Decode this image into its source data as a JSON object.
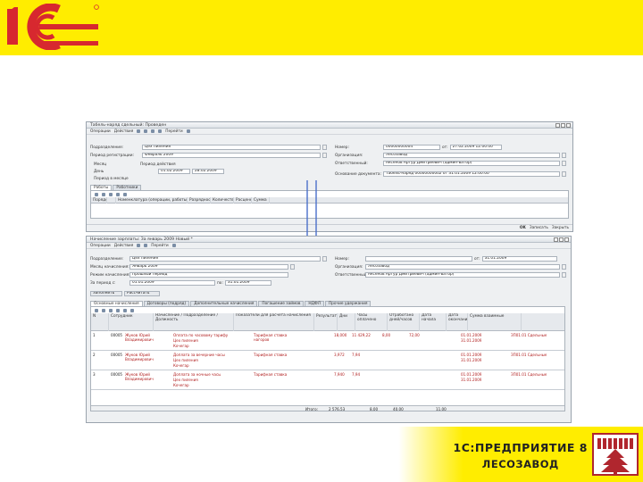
{
  "brand": {
    "logo_text": "1С",
    "accent": "#ffed00",
    "logo_color": "#d7282f"
  },
  "product": {
    "line1": "1С:ПРЕДПРИЯТИЕ 8",
    "line2": "ЛЕСОЗАВОД"
  },
  "win1": {
    "title": "Табель-наряд сдельный: Проведен",
    "toolbar": [
      "Операции",
      "Действия",
      "Перейти"
    ],
    "left_fields": [
      {
        "label": "Подразделение:",
        "value": "Цех пиления"
      },
      {
        "label": "Период регистрации:",
        "value": "Февраль 2009"
      }
    ],
    "period": {
      "label": "Период действия",
      "opt1": "Месяц",
      "opt2": "День",
      "opt3": "Период в месяце",
      "from": "01.02.2009",
      "to": "28.02.2009"
    },
    "right_fields": [
      {
        "label": "Номер:",
        "value": "00000000004",
        "date_label": "от:",
        "date": "27.02.2009 12:00:00"
      },
      {
        "label": "Организация:",
        "value": "Лесозавод"
      },
      {
        "label": "Ответственный:",
        "value": "Аксенов Артур Дмитриевич (админ-ватор)"
      },
      {
        "label": "Основание документа:",
        "value": "Табель-наряд 00000000002 от 31.01.2009 12:00:00"
      }
    ],
    "tabs": [
      "Работы",
      "Работники"
    ],
    "grid_header": [
      "Порядок",
      "",
      "Номенклатура (операции, работы)",
      "Разрядность",
      "Количество",
      "Расценка",
      "Сумма"
    ],
    "bottom": {
      "ok": "OK",
      "write": "Записать",
      "close": "Закрыть"
    }
  },
  "win2": {
    "title": "Начисление зарплаты: За январь 2009 Новый *",
    "toolbar": [
      "Операции",
      "Действия",
      "Перейти"
    ],
    "left_fields": [
      {
        "label": "Подразделение:",
        "value": "Цех пиления"
      },
      {
        "label": "Месяц начисления:",
        "value": "Январь 2009"
      },
      {
        "label": "Режим начисления:",
        "value": "Прошлый период"
      },
      {
        "label": "За период с:",
        "value": "01.01.2009",
        "to_label": "по:",
        "to": "31.01.2009"
      }
    ],
    "right_fields": [
      {
        "label": "Номер:",
        "value": "",
        "date_label": "от:",
        "date": "31.01.2009"
      },
      {
        "label": "Организация:",
        "value": "Лесозавод"
      },
      {
        "label": "Ответственный:",
        "value": "Аксенов Артур Дмитриевич (админ-ватор)"
      }
    ],
    "actions": [
      "Заполнить",
      "Рассчитать"
    ],
    "tabs": [
      "Основные начисления",
      "Договоры (подряд)",
      "Дополнительные начисления",
      "Погашение займов",
      "НДФЛ",
      "Прочие удержания"
    ],
    "columns": [
      "N",
      "Сотрудник",
      "Начисление / Подразделение / Должность",
      "Показатели для расчета начисления",
      "Результат",
      "Дни",
      "Часы оплачено",
      "Отработано дней/часов",
      "Дата начала",
      "Дата окончания",
      "Сумма взаимные"
    ],
    "rows": [
      {
        "n": "1",
        "code": "00005",
        "emp": "Жуков Юрий",
        "emp2": "Владимирович",
        "acc": "Оплата по часовому тарифу",
        "dept": "Цех пиления",
        "pos": "Кочегар",
        "basis": "Тарифная ставка",
        "basis2": "нагоров",
        "res": "18,000",
        "sum": "11 429,22",
        "days": "8,00",
        "hours": "72,00",
        "d1": "01.01.2009",
        "d2": "31.01.2009",
        "right": "ЗП01.01 Сдельные"
      },
      {
        "n": "2",
        "code": "00005",
        "emp": "Жуков Юрий",
        "emp2": "Владимирович",
        "acc": "Доплата за вечерние часы",
        "dept": "Цех пиления",
        "pos": "Кочегар",
        "basis": "Тарифная ставка",
        "basis2": "",
        "res": "3,972",
        "sum": "7,94",
        "days": "",
        "hours": "",
        "d1": "01.01.2009",
        "d2": "31.01.2009",
        "right": "ЗП01.01 Сдельные"
      },
      {
        "n": "3",
        "code": "00005",
        "emp": "Жуков Юрий",
        "emp2": "Владимирович",
        "acc": "Доплата за ночные часы",
        "dept": "Цех пиления",
        "pos": "Кочегар",
        "basis": "Тарифная ставка",
        "basis2": "",
        "res": "7,940",
        "sum": "7,94",
        "days": "",
        "hours": "",
        "d1": "01.01.2009",
        "d2": "31.01.2009",
        "right": "ЗП01.01 Сдельные"
      }
    ],
    "totals": {
      "label": "Итого:",
      "sum": "2 576,53",
      "days": "8,00",
      "hours": "40,00",
      "worked": "11,00"
    }
  }
}
